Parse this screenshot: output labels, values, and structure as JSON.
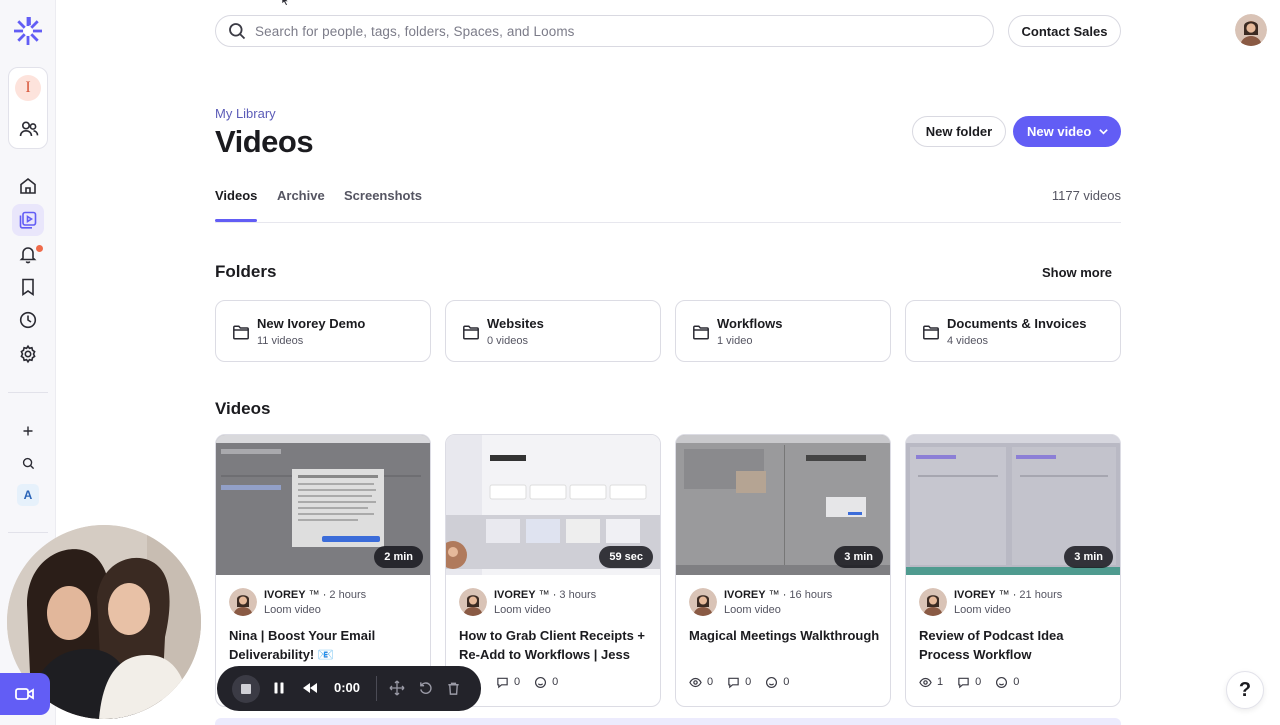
{
  "search": {
    "placeholder": "Search for people, tags, folders, Spaces, and Looms"
  },
  "topbar": {
    "contact_label": "Contact Sales"
  },
  "rail": {
    "workspace_initial": "I",
    "space_letter": "A"
  },
  "header": {
    "breadcrumb": "My Library",
    "title": "Videos",
    "new_folder_label": "New folder",
    "new_video_label": "New video"
  },
  "tabs": {
    "items": [
      {
        "label": "Videos"
      },
      {
        "label": "Archive"
      },
      {
        "label": "Screenshots"
      }
    ],
    "video_count": "1177 videos"
  },
  "folders": {
    "title": "Folders",
    "show_more_label": "Show more",
    "items": [
      {
        "name": "New Ivorey Demo",
        "count": "11 videos"
      },
      {
        "name": "Websites",
        "count": "0 videos"
      },
      {
        "name": "Workflows",
        "count": "1 video"
      },
      {
        "name": "Documents & Invoices",
        "count": "4 videos"
      }
    ]
  },
  "videos": {
    "title": "Videos",
    "items": [
      {
        "duration": "2 min",
        "owner": "IVOREY",
        "owner_mark": "™",
        "age": "2 hours",
        "type": "Loom video",
        "title": "Nina | Boost Your Email Deliverability! 📧",
        "views": "",
        "comments": "",
        "reactions": ""
      },
      {
        "duration": "59 sec",
        "owner": "IVOREY",
        "owner_mark": "™",
        "age": "3 hours",
        "type": "Loom video",
        "title": "How to Grab Client Receipts + Re-Add to Workflows | Jess",
        "views": "",
        "comments": "0",
        "reactions": "0"
      },
      {
        "duration": "3 min",
        "owner": "IVOREY",
        "owner_mark": "™",
        "age": "16 hours",
        "type": "Loom video",
        "title": "Magical Meetings Walkthrough",
        "views": "0",
        "comments": "0",
        "reactions": "0"
      },
      {
        "duration": "3 min",
        "owner": "IVOREY",
        "owner_mark": "™",
        "age": "21 hours",
        "type": "Loom video",
        "title": "Review of Podcast Idea Process Workflow",
        "views": "1",
        "comments": "0",
        "reactions": "0"
      }
    ]
  },
  "recorder": {
    "elapsed": "0:00"
  },
  "help": {
    "label": "?"
  },
  "colors": {
    "accent": "#625df5",
    "accent_soft": "#e9e6fb",
    "notification": "#ef6a4a"
  }
}
